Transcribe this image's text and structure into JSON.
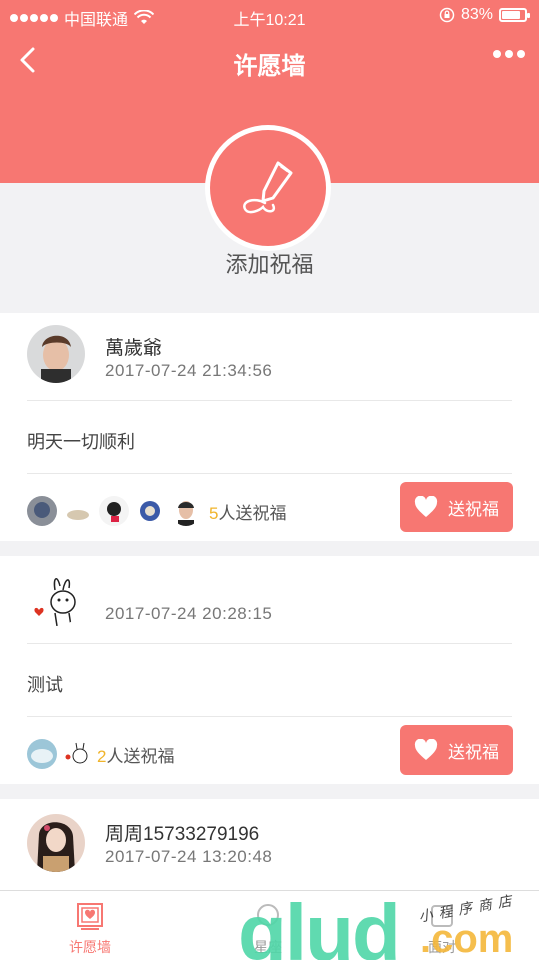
{
  "status_bar": {
    "carrier": "中国联通",
    "time": "上午10:21",
    "battery": "83%",
    "battery_level": 0.83
  },
  "nav": {
    "title": "许愿墙"
  },
  "add": {
    "label": "添加祝福"
  },
  "posts": [
    {
      "name": "萬歲爺",
      "time": "2017-07-24 21:34:56",
      "content": "明天一切顺利",
      "bless_count": "5",
      "bless_suffix": "人送祝福",
      "button_label": "送祝福"
    },
    {
      "name": "",
      "time": "2017-07-24 20:28:15",
      "content": "测试",
      "bless_count": "2",
      "bless_suffix": "人送祝福",
      "button_label": "送祝福"
    },
    {
      "name": "周周15733279196",
      "time": "2017-07-24 13:20:48"
    }
  ],
  "tabs": {
    "wish_wall": "许愿墙",
    "tab2": "星座",
    "tab3": "面对"
  },
  "watermark": {
    "main": "glud",
    "com": ".com",
    "tagline": "小程序商店"
  },
  "colors": {
    "accent": "#f77772",
    "count": "#f0b42b"
  }
}
